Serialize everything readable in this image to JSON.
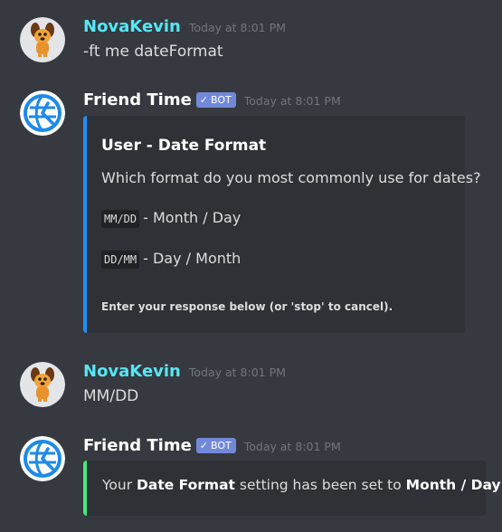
{
  "messages": [
    {
      "author": "NovaKevin",
      "author_color": "#55e7f5",
      "avatar_icon": "dog-avatar-icon",
      "timestamp": "Today at 8:01 PM",
      "text": "-ft me dateFormat"
    },
    {
      "author": "Friend Time",
      "author_color": "#ffffff",
      "avatar_icon": "globe-clock-icon",
      "bot_tag": "BOT",
      "timestamp": "Today at 8:01 PM",
      "embed": {
        "accent_color": "#1e90ff",
        "title": "User - Date Format",
        "description": "Which format do you most commonly use for dates?",
        "options": [
          {
            "code": "MM/DD",
            "label": "- Month / Day"
          },
          {
            "code": "DD/MM",
            "label": "- Day / Month"
          }
        ],
        "footer": "Enter your response below (or 'stop' to cancel)."
      }
    },
    {
      "author": "NovaKevin",
      "author_color": "#55e7f5",
      "avatar_icon": "dog-avatar-icon",
      "timestamp": "Today at 8:01 PM",
      "text": "MM/DD"
    },
    {
      "author": "Friend Time",
      "author_color": "#ffffff",
      "avatar_icon": "globe-clock-icon",
      "bot_tag": "BOT",
      "timestamp": "Today at 8:01 PM",
      "embed": {
        "accent_color": "#43e97b",
        "prefix": "Your ",
        "setting": "Date Format",
        "middle": " setting has been set to ",
        "value": "Month / Day",
        "suffix": "."
      }
    }
  ],
  "colors": {
    "background": "#36393f",
    "embed_background": "#2f3136",
    "bot_tag": "#7289da",
    "timestamp": "#72767d"
  }
}
